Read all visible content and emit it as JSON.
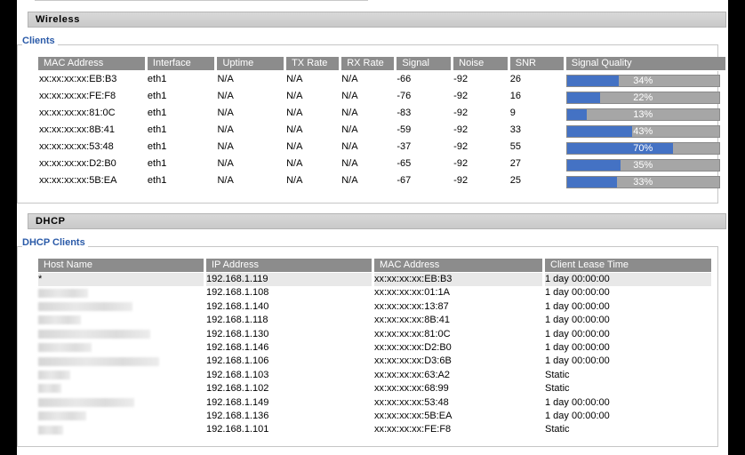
{
  "wireless": {
    "section_title": "Wireless",
    "clients_legend": "Clients",
    "columns": [
      "MAC Address",
      "Interface",
      "Uptime",
      "TX Rate",
      "RX Rate",
      "Signal",
      "Noise",
      "SNR",
      "Signal Quality"
    ],
    "rows": [
      {
        "mac": "xx:xx:xx:xx:EB:B3",
        "iface": "eth1",
        "uptime": "N/A",
        "tx": "N/A",
        "rx": "N/A",
        "signal": "-66",
        "noise": "-92",
        "snr": "26",
        "quality": 34,
        "quality_label": "34%"
      },
      {
        "mac": "xx:xx:xx:xx:FE:F8",
        "iface": "eth1",
        "uptime": "N/A",
        "tx": "N/A",
        "rx": "N/A",
        "signal": "-76",
        "noise": "-92",
        "snr": "16",
        "quality": 22,
        "quality_label": "22%"
      },
      {
        "mac": "xx:xx:xx:xx:81:0C",
        "iface": "eth1",
        "uptime": "N/A",
        "tx": "N/A",
        "rx": "N/A",
        "signal": "-83",
        "noise": "-92",
        "snr": "9",
        "quality": 13,
        "quality_label": "13%"
      },
      {
        "mac": "xx:xx:xx:xx:8B:41",
        "iface": "eth1",
        "uptime": "N/A",
        "tx": "N/A",
        "rx": "N/A",
        "signal": "-59",
        "noise": "-92",
        "snr": "33",
        "quality": 43,
        "quality_label": "43%"
      },
      {
        "mac": "xx:xx:xx:xx:53:48",
        "iface": "eth1",
        "uptime": "N/A",
        "tx": "N/A",
        "rx": "N/A",
        "signal": "-37",
        "noise": "-92",
        "snr": "55",
        "quality": 70,
        "quality_label": "70%"
      },
      {
        "mac": "xx:xx:xx:xx:D2:B0",
        "iface": "eth1",
        "uptime": "N/A",
        "tx": "N/A",
        "rx": "N/A",
        "signal": "-65",
        "noise": "-92",
        "snr": "27",
        "quality": 35,
        "quality_label": "35%"
      },
      {
        "mac": "xx:xx:xx:xx:5B:EA",
        "iface": "eth1",
        "uptime": "N/A",
        "tx": "N/A",
        "rx": "N/A",
        "signal": "-67",
        "noise": "-92",
        "snr": "25",
        "quality": 33,
        "quality_label": "33%"
      }
    ]
  },
  "dhcp": {
    "section_title": "DHCP",
    "clients_legend": "DHCP Clients",
    "columns": [
      "Host Name",
      "IP Address",
      "MAC Address",
      "Client Lease Time"
    ],
    "rows": [
      {
        "host": "*",
        "ip": "192.168.1.119",
        "mac": "xx:xx:xx:xx:EB:B3",
        "lease": "1 day 00:00:00"
      },
      {
        "host": "",
        "ip": "192.168.1.108",
        "mac": "xx:xx:xx:xx:01:1A",
        "lease": "1 day 00:00:00"
      },
      {
        "host": "",
        "ip": "192.168.1.140",
        "mac": "xx:xx:xx:xx:13:87",
        "lease": "1 day 00:00:00"
      },
      {
        "host": "",
        "ip": "192.168.1.118",
        "mac": "xx:xx:xx:xx:8B:41",
        "lease": "1 day 00:00:00"
      },
      {
        "host": "",
        "ip": "192.168.1.130",
        "mac": "xx:xx:xx:xx:81:0C",
        "lease": "1 day 00:00:00"
      },
      {
        "host": "",
        "ip": "192.168.1.146",
        "mac": "xx:xx:xx:xx:D2:B0",
        "lease": "1 day 00:00:00"
      },
      {
        "host": "",
        "ip": "192.168.1.106",
        "mac": "xx:xx:xx:xx:D3:6B",
        "lease": "1 day 00:00:00"
      },
      {
        "host": "",
        "ip": "192.168.1.103",
        "mac": "xx:xx:xx:xx:63:A2",
        "lease": "Static"
      },
      {
        "host": "",
        "ip": "192.168.1.102",
        "mac": "xx:xx:xx:xx:68:99",
        "lease": "Static"
      },
      {
        "host": "",
        "ip": "192.168.1.149",
        "mac": "xx:xx:xx:xx:53:48",
        "lease": "1 day 00:00:00"
      },
      {
        "host": "",
        "ip": "192.168.1.136",
        "mac": "xx:xx:xx:xx:5B:EA",
        "lease": "1 day 00:00:00"
      },
      {
        "host": "",
        "ip": "192.168.1.101",
        "mac": "xx:xx:xx:xx:FE:F8",
        "lease": "Static"
      }
    ]
  }
}
